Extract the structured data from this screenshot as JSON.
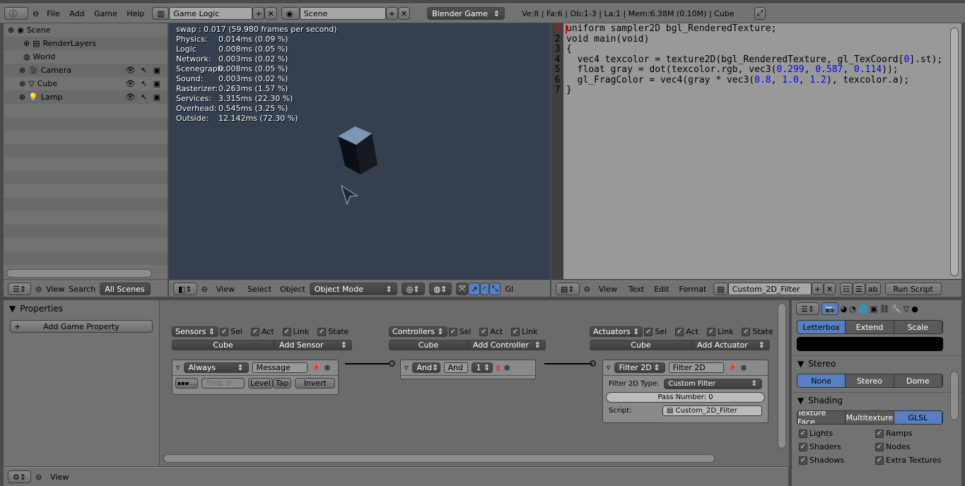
{
  "topbar": {
    "menus": [
      "File",
      "Add",
      "Game",
      "Help"
    ],
    "screen": "Game Logic",
    "scene": "Scene",
    "engine": "Blender Game",
    "stats": "Ve:8 | Fa:6 | Ob:1-3 | La:1 | Mem:6.38M (0.10M) | Cube"
  },
  "outliner": {
    "items": [
      {
        "label": "Scene",
        "icon": "scene-icon"
      },
      {
        "label": "RenderLayers",
        "icon": "render-layers-icon"
      },
      {
        "label": "World",
        "icon": "world-icon"
      },
      {
        "label": "Camera",
        "icon": "camera-icon"
      },
      {
        "label": "Cube",
        "icon": "mesh-icon"
      },
      {
        "label": "Lamp",
        "icon": "lamp-icon"
      }
    ],
    "header": {
      "view": "View",
      "search": "Search",
      "filter": "All Scenes"
    }
  },
  "viewport": {
    "stats": [
      {
        "k": "swap :",
        "v": "0.017 (59.980 frames per second)"
      },
      {
        "k": "Physics:",
        "v": "0.014ms (0.09 %)"
      },
      {
        "k": "Logic",
        "v": "0.008ms (0.05 %)"
      },
      {
        "k": "Network:",
        "v": "0.003ms (0.02 %)"
      },
      {
        "k": "Scenegraph:",
        "v": "0.008ms (0.05 %)"
      },
      {
        "k": "Sound:",
        "v": "0.003ms (0.02 %)"
      },
      {
        "k": "Rasterizer:",
        "v": "0.263ms (1.57 %)"
      },
      {
        "k": "Services:",
        "v": "3.315ms (22.30 %)"
      },
      {
        "k": "Overhead:",
        "v": "0.545ms (3.25 %)"
      },
      {
        "k": "Outside:",
        "v": "12.142ms (72.30 %)"
      }
    ],
    "header": {
      "view": "View",
      "select": "Select",
      "object": "Object",
      "mode": "Object Mode",
      "gl": "Gl"
    }
  },
  "text_editor": {
    "lines": [
      "uniform sampler2D bgl_RenderedTexture;",
      "void main(void)",
      "{",
      "  vec4 texcolor = texture2D(bgl_RenderedTexture, gl_TexCoord[0].st);",
      "  float gray = dot(texcolor.rgb, vec3(0.299, 0.587, 0.114));",
      "  gl_FragColor = vec4(gray * vec3(0.8, 1.0, 1.2), texcolor.a);",
      "}"
    ],
    "header": {
      "view": "View",
      "text": "Text",
      "edit": "Edit",
      "format": "Format",
      "file": "Custom_2D_Filter",
      "run": "Run Script"
    }
  },
  "properties": {
    "title": "Properties",
    "add": "Add Game Property"
  },
  "logic": {
    "sensors": {
      "menu": "Sensors",
      "sel": "Sel",
      "act": "Act",
      "link": "Link",
      "state": "State",
      "obj": "Cube",
      "add": "Add Sensor",
      "brick": {
        "type": "Always",
        "name": "Message",
        "freq": "Freq: 0",
        "level": "Level",
        "tap": "Tap",
        "invert": "Invert"
      }
    },
    "controllers": {
      "menu": "Controllers",
      "sel": "Sel",
      "act": "Act",
      "link": "Link",
      "obj": "Cube",
      "add": "Add Controller",
      "brick": {
        "type": "And",
        "name": "And",
        "state": "1"
      }
    },
    "actuators": {
      "menu": "Actuators",
      "sel": "Sel",
      "act": "Act",
      "link": "Link",
      "state": "State",
      "obj": "Cube",
      "add": "Add Actuator",
      "brick": {
        "type": "Filter 2D",
        "name": "Filter 2D",
        "type_label": "Filter 2D Type:",
        "filter": "Custom Filter",
        "pass": "Pass Number: 0",
        "script_label": "Script:",
        "script": "Custom_2D_Filter"
      }
    }
  },
  "render": {
    "framing": [
      "Letterbox",
      "Extend",
      "Scale"
    ],
    "framing_active": "Letterbox",
    "stereo_title": "Stereo",
    "stereo": [
      "None",
      "Stereo",
      "Dome"
    ],
    "stereo_active": "None",
    "shading_title": "Shading",
    "shading": [
      "Texture Face",
      "Multitexture",
      "GLSL"
    ],
    "shading_active": "GLSL",
    "checks": [
      {
        "label": "Lights",
        "checked": true
      },
      {
        "label": "Ramps",
        "checked": true
      },
      {
        "label": "Shaders",
        "checked": true
      },
      {
        "label": "Nodes",
        "checked": true
      },
      {
        "label": "Shadows",
        "checked": true
      },
      {
        "label": "Extra Textures",
        "checked": true
      }
    ]
  },
  "bottom": {
    "view": "View"
  },
  "colors": {
    "accent": "#5680c2",
    "viewport_bg": "#34404f",
    "code_number": "#0000ff"
  }
}
